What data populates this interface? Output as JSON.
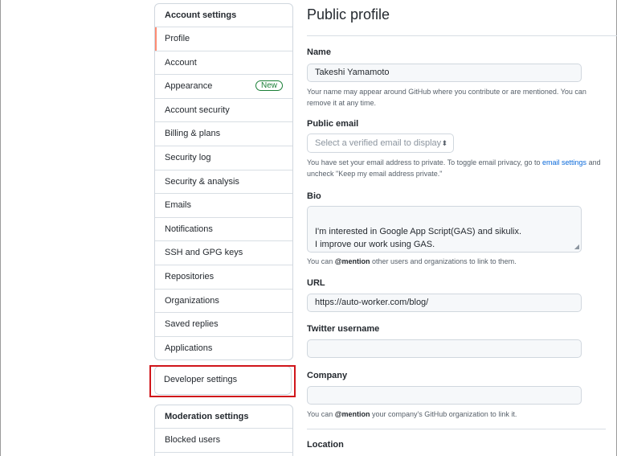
{
  "sidebar": {
    "account_heading": "Account settings",
    "items": [
      {
        "label": "Profile"
      },
      {
        "label": "Account"
      },
      {
        "label": "Appearance",
        "badge": "New"
      },
      {
        "label": "Account security"
      },
      {
        "label": "Billing & plans"
      },
      {
        "label": "Security log"
      },
      {
        "label": "Security & analysis"
      },
      {
        "label": "Emails"
      },
      {
        "label": "Notifications"
      },
      {
        "label": "SSH and GPG keys"
      },
      {
        "label": "Repositories"
      },
      {
        "label": "Organizations"
      },
      {
        "label": "Saved replies"
      },
      {
        "label": "Applications"
      }
    ],
    "developer_settings": "Developer settings",
    "moderation_heading": "Moderation settings",
    "moderation_items": [
      {
        "label": "Blocked users"
      }
    ]
  },
  "profile": {
    "title": "Public profile",
    "name_label": "Name",
    "name_value": "Takeshi Yamamoto",
    "name_note": "Your name may appear around GitHub where you contribute or are mentioned. You can remove it at any time.",
    "email_label": "Public email",
    "email_placeholder": "Select a verified email to display",
    "email_note_before": "You have set your email address to private. To toggle email privacy, go to",
    "email_note_link": "email settings",
    "email_note_after": "and uncheck \"Keep my email address private.\"",
    "bio_label": "Bio",
    "bio_value": "I'm interested in Google App Script(GAS) and sikulix.\n I improve our work using GAS.",
    "bio_note_prefix": "You can",
    "bio_note_mention": "@mention",
    "bio_note_suffix": "other users and organizations to link to them.",
    "url_label": "URL",
    "url_value": "https://auto-worker.com/blog/",
    "twitter_label": "Twitter username",
    "twitter_value": "",
    "company_label": "Company",
    "company_value": "",
    "company_note_prefix": "You can",
    "company_note_mention": "@mention",
    "company_note_suffix": "your company's GitHub organization to link it.",
    "location_label": "Location"
  },
  "colors": {
    "accent": "#fd8c73",
    "link": "#0969da",
    "badge_green": "#1a7f37",
    "highlight_red": "#d0161b"
  }
}
